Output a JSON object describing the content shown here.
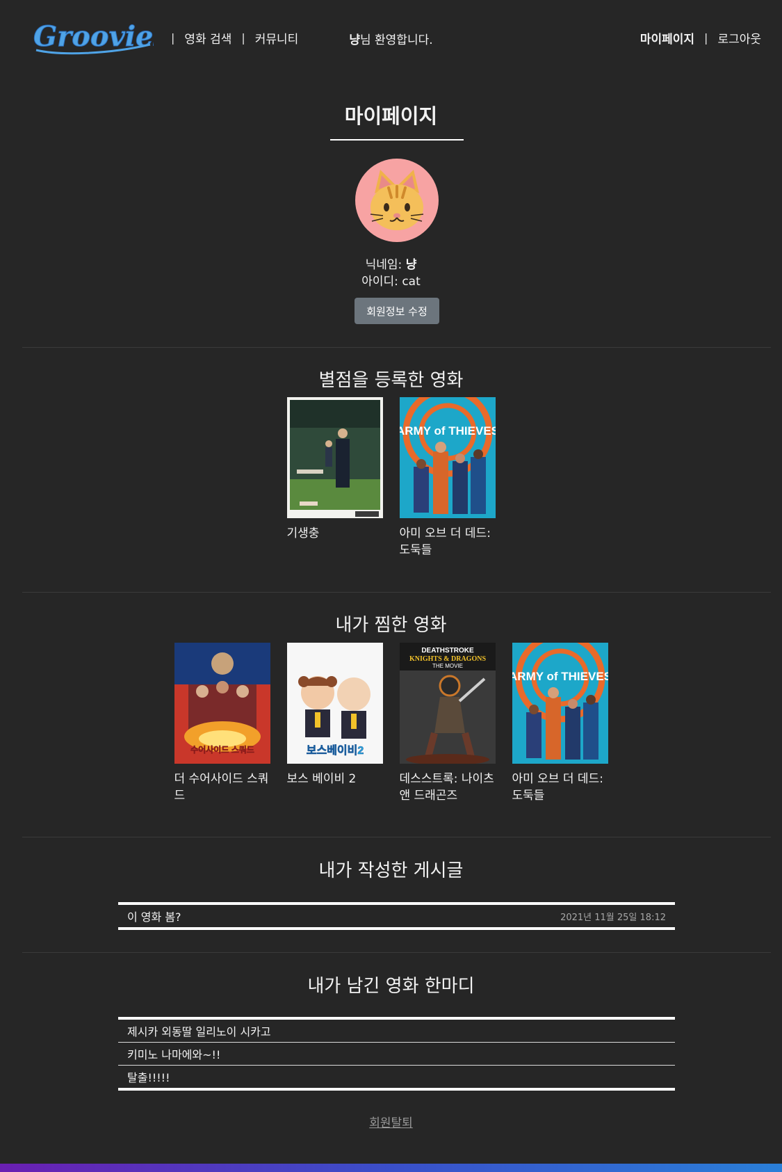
{
  "header": {
    "logo_text": "Groovies",
    "nav_left": [
      {
        "label": "영화 검색"
      },
      {
        "label": "커뮤니티"
      }
    ],
    "separator": "|",
    "welcome_name": "냥",
    "welcome_suffix": "님 환영합니다.",
    "nav_right": [
      {
        "label": "마이페이지"
      },
      {
        "label": "로그아웃"
      }
    ]
  },
  "profile": {
    "page_title": "마이페이지",
    "avatar_icon": "cat-face-icon",
    "nickname_label": "닉네임: ",
    "nickname": "냥",
    "id_label": "아이디: ",
    "user_id": "cat",
    "edit_button": "회원정보 수정"
  },
  "rated_movies": {
    "title": "별점을 등록한 영화",
    "items": [
      {
        "title": "기생충"
      },
      {
        "title": "아미 오브 더 데드: 도둑들"
      }
    ]
  },
  "liked_movies": {
    "title": "내가 찜한 영화",
    "items": [
      {
        "title": "더 수어사이드 스쿼드",
        "poster_text": "수어사이드 스쿼드"
      },
      {
        "title": "보스 베이비 2",
        "poster_text": "보스베이비2"
      },
      {
        "title": "데스스트록: 나이츠 앤 드래곤즈",
        "poster_text": "DEATHSTROKE KNIGHTS & DRAGONS THE MOVIE"
      },
      {
        "title": "아미 오브 더 데드: 도둑들",
        "poster_text": "ARMY of THIEVES"
      }
    ]
  },
  "posts": {
    "title": "내가 작성한 게시글",
    "items": [
      {
        "title": "이 영화 봄?",
        "date": "2021년 11월 25일 18:12"
      }
    ]
  },
  "comments": {
    "title": "내가 남긴 영화 한마디",
    "items": [
      {
        "text": "제시카 외동딸 일리노이 시카고"
      },
      {
        "text": "키미노 나마에와~!!"
      },
      {
        "text": "탈출!!!!!"
      }
    ]
  },
  "withdraw_label": "회원탈퇴",
  "colors": {
    "background": "#262626",
    "edit_button": "#6c757d",
    "avatar_bg": "#f7a3a3",
    "bottom_bar_start": "#6a1fb2",
    "bottom_bar_end": "#2a7fd8"
  }
}
